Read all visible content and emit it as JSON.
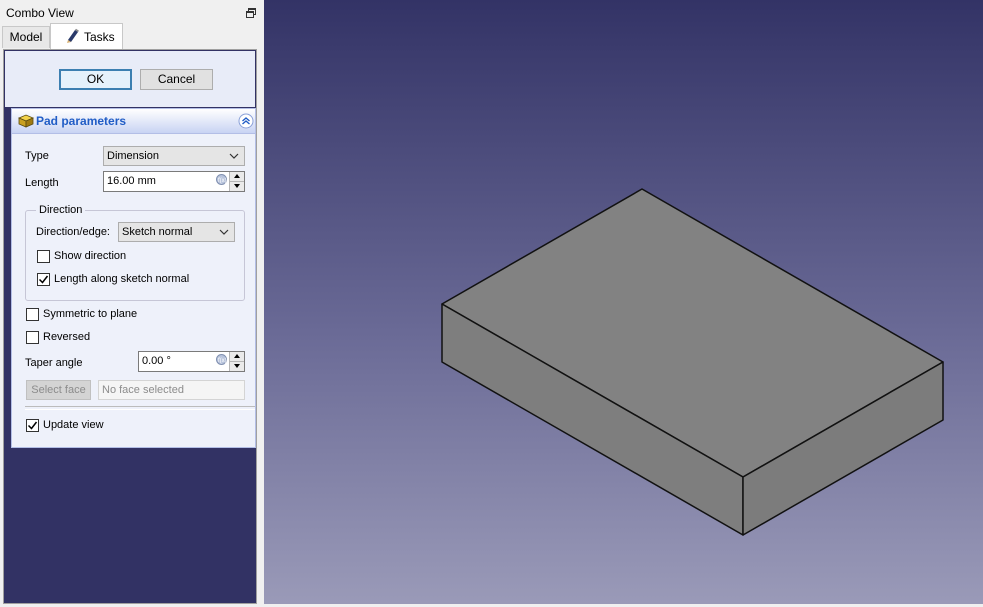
{
  "combo_view": {
    "title": "Combo View",
    "tabs": {
      "model": "Model",
      "tasks": "Tasks"
    }
  },
  "buttons": {
    "ok": "OK",
    "cancel": "Cancel"
  },
  "pad_parameters": {
    "title": "Pad parameters",
    "type_label": "Type",
    "type_value": "Dimension",
    "length_label": "Length",
    "length_value": "16.00 mm",
    "direction": {
      "group_title": "Direction",
      "edge_label": "Direction/edge:",
      "edge_value": "Sketch normal",
      "show_direction": {
        "label": "Show direction",
        "checked": false
      },
      "length_along_normal": {
        "label": "Length along sketch normal",
        "checked": true
      }
    },
    "symmetric": {
      "label": "Symmetric to plane",
      "checked": false
    },
    "reversed": {
      "label": "Reversed",
      "checked": false
    },
    "taper_label": "Taper angle",
    "taper_value": "0.00 °",
    "select_face_label": "Select face",
    "face_placeholder": "No face selected",
    "update_view": {
      "label": "Update view",
      "checked": true
    }
  },
  "colors": {
    "panel_bg": "#323264",
    "viewport_top": "#333366",
    "viewport_bottom": "#9a9ab8",
    "box_face": "#7f7f7f",
    "header_title": "#215dc6"
  }
}
